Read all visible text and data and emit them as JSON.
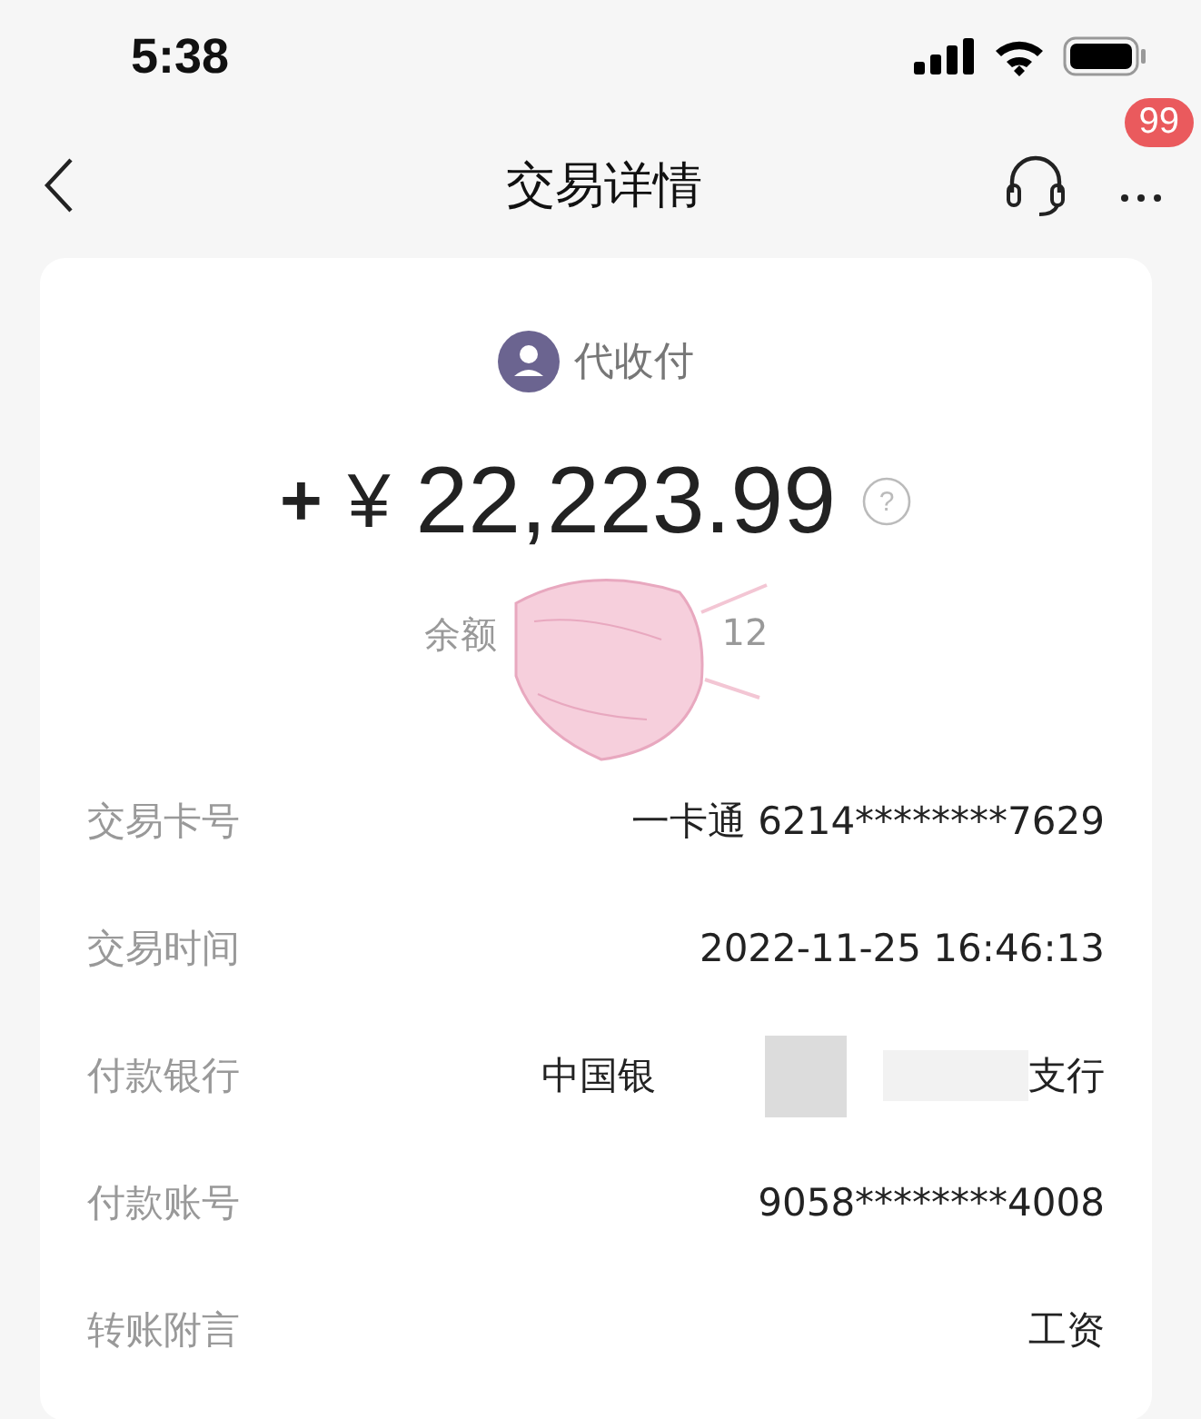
{
  "status_bar": {
    "time": "5:38"
  },
  "nav": {
    "title": "交易详情",
    "badge": "99"
  },
  "summary": {
    "type": "代收付",
    "sign": "+",
    "currency": "¥",
    "amount": "22,223.99",
    "help": "?",
    "balance_label": "余额",
    "balance_value": "12",
    "covered": true
  },
  "details": [
    {
      "label": "交易卡号",
      "value": "一卡通 6214********7629"
    },
    {
      "label": "交易时间",
      "value": "2022-11-25 16:46:13"
    },
    {
      "label": "付款银行",
      "value": "中国银",
      "redacted": true,
      "value_end": "支行"
    },
    {
      "label": "付款账号",
      "value": "9058********4008"
    },
    {
      "label": "转账附言",
      "value": "工资"
    }
  ]
}
